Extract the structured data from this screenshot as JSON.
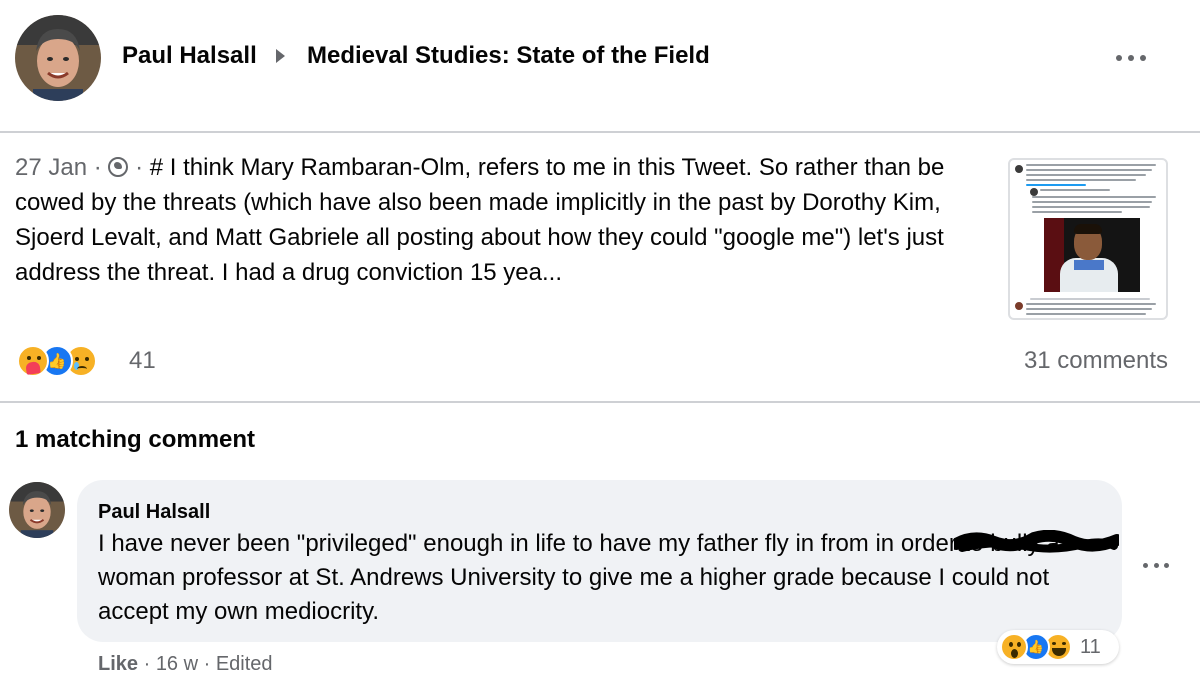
{
  "post": {
    "author": "Paul Halsall",
    "group": "Medieval Studies: State of the Field",
    "date": "27 Jan",
    "separator": "·",
    "text": "# I think Mary Rambaran-Olm, refers to me in this Tweet. So rather than be cowed by the threats (which have also been made implicitly in the past by Dorothy Kim, Sjoerd Levalt, and Matt Gabriele all posting about how they could \"google me\") let's just address the threat. I had a drug conviction 15 yea...",
    "privacy_icon": "globe-icon",
    "reaction_icons": [
      "care-reaction-icon",
      "like-reaction-icon",
      "sad-reaction-icon"
    ],
    "reaction_count": "41",
    "comment_count": "31 comments"
  },
  "matching": {
    "heading": "1 matching comment"
  },
  "comment": {
    "author": "Paul Halsall",
    "text": "I have never been \"privileged\" enough in life to have my father fly in from         in order to bully a woman professor at St. Andrews University to give me a higher grade because I could not accept my own mediocrity.",
    "reaction_icons": [
      "wow-reaction-icon",
      "like-reaction-icon",
      "haha-reaction-icon"
    ],
    "reaction_count": "11",
    "like_label": "Like",
    "time": "16 w",
    "edited": "Edited"
  },
  "colors": {
    "text": "#050505",
    "secondary": "#65676b",
    "bubble": "#f0f2f5",
    "like_blue": "#1877f2",
    "reaction_yellow": "#f7b125",
    "divider": "#ced0d4"
  }
}
